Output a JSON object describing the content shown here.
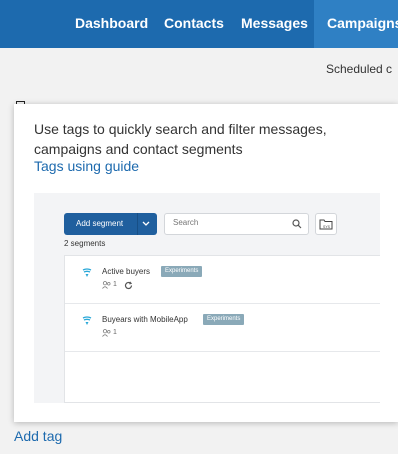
{
  "nav": {
    "items": [
      {
        "label": "Dashboard",
        "active": false
      },
      {
        "label": "Contacts",
        "active": false
      },
      {
        "label": "Messages",
        "active": false
      },
      {
        "label": "Campaigns",
        "active": true
      }
    ]
  },
  "page": {
    "scheduled_text": "Scheduled c",
    "add_tag_label": "Add tag"
  },
  "tooltip": {
    "text": "Use tags to quickly search and filter messages, campaigns and contact segments",
    "link_label": "Tags using guide",
    "preview": {
      "add_segment_label": "Add segment",
      "search_placeholder": "Search",
      "segment_count": "2 segments",
      "segments": [
        {
          "name": "Active buyers",
          "badge": "Experiments",
          "users": "1",
          "icons": [
            "funnel-icon",
            "user-icon",
            "refresh-icon"
          ]
        },
        {
          "name": "Buyears with MobileApp",
          "badge": "Experiments",
          "users": "1",
          "icons": [
            "funnel-icon",
            "user-icon"
          ]
        }
      ]
    }
  },
  "colors": {
    "nav_bg": "#1d6aae",
    "nav_active": "#2f80c4",
    "link": "#1d6aae",
    "button": "#1f5f9e",
    "badge": "#8aa9b8",
    "funnel": "#2aa8d8"
  }
}
